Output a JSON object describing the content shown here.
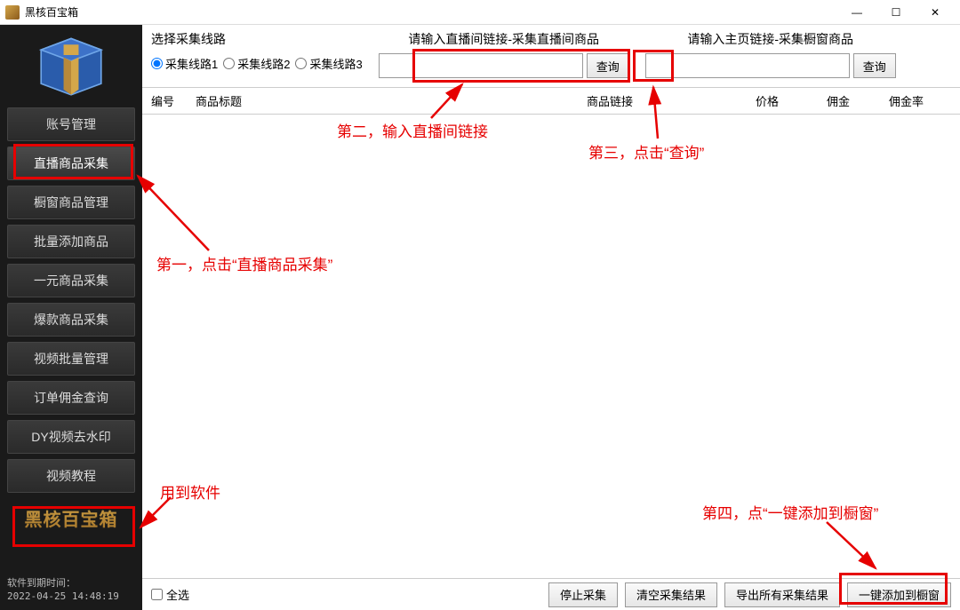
{
  "window": {
    "title": "黑核百宝箱"
  },
  "sidebar": {
    "items": [
      {
        "label": "账号管理"
      },
      {
        "label": "直播商品采集"
      },
      {
        "label": "橱窗商品管理"
      },
      {
        "label": "批量添加商品"
      },
      {
        "label": "一元商品采集"
      },
      {
        "label": "爆款商品采集"
      },
      {
        "label": "视频批量管理"
      },
      {
        "label": "订单佣金查询"
      },
      {
        "label": "DY视频去水印"
      },
      {
        "label": "视频教程"
      }
    ],
    "brand": "黑核百宝箱",
    "footer_line1": "软件到期时间：",
    "footer_line2": "2022-04-25 14:48:19"
  },
  "toolbar": {
    "route_label": "选择采集线路",
    "routes": [
      {
        "label": "采集线路1",
        "checked": true
      },
      {
        "label": "采集线路2",
        "checked": false
      },
      {
        "label": "采集线路3",
        "checked": false
      }
    ],
    "live": {
      "label": "请输入直播间链接-采集直播间商品",
      "btn": "查询"
    },
    "shop": {
      "label": "请输入主页链接-采集橱窗商品",
      "btn": "查询"
    }
  },
  "table": {
    "headers": {
      "id": "编号",
      "title": "商品标题",
      "link": "商品链接",
      "price": "价格",
      "comm": "佣金",
      "rate": "佣金率"
    }
  },
  "footer": {
    "select_all": "全选",
    "stop": "停止采集",
    "clear": "清空采集结果",
    "export": "导出所有采集结果",
    "add": "一键添加到橱窗"
  },
  "annotations": {
    "step1": "第一，点击“直播商品采集”",
    "step2": "第二，输入直播间链接",
    "step3": "第三，点击“查询”",
    "step4": "第四，点“一键添加到橱窗”",
    "soft": "用到软件"
  }
}
